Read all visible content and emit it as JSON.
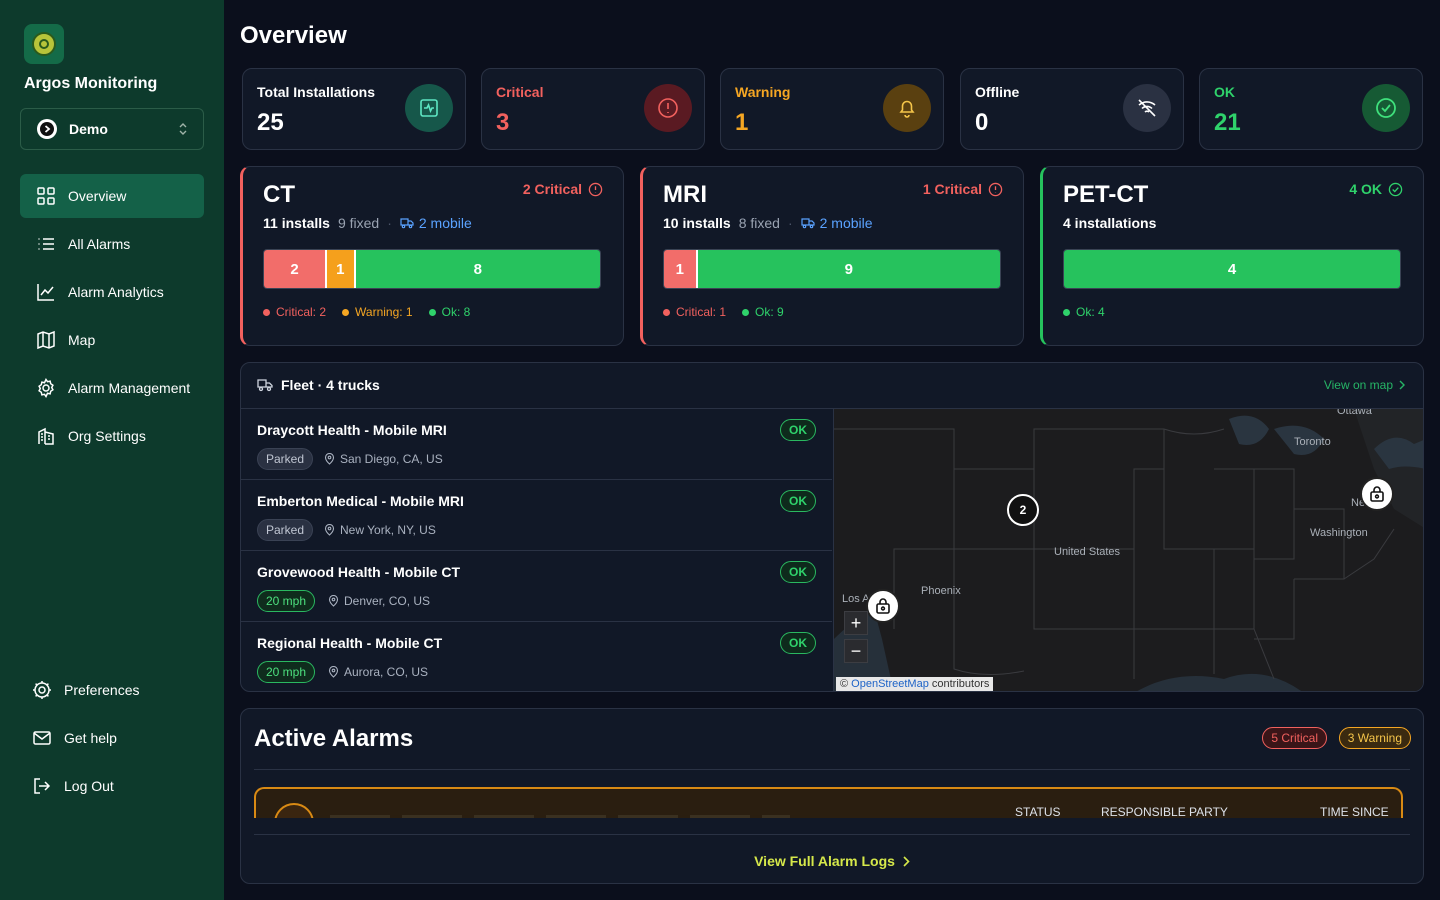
{
  "app": {
    "name": "Argos Monitoring",
    "org": "Demo"
  },
  "nav": {
    "items": [
      {
        "label": "Overview",
        "icon": "grid-icon",
        "active": true
      },
      {
        "label": "All Alarms",
        "icon": "list-icon"
      },
      {
        "label": "Alarm Analytics",
        "icon": "chart-line-icon"
      },
      {
        "label": "Map",
        "icon": "map-icon"
      },
      {
        "label": "Alarm Management",
        "icon": "gear-icon"
      },
      {
        "label": "Org Settings",
        "icon": "building-icon"
      }
    ],
    "bottom": [
      {
        "label": "Preferences",
        "icon": "cog-icon"
      },
      {
        "label": "Get help",
        "icon": "mail-icon"
      },
      {
        "label": "Log Out",
        "icon": "logout-icon"
      }
    ]
  },
  "page": {
    "title": "Overview"
  },
  "stats": [
    {
      "label": "Total Installations",
      "value": "25",
      "color": "#ffffff",
      "icon": "activity-icon"
    },
    {
      "label": "Critical",
      "value": "3",
      "color": "#f2615e",
      "icon": "alert-circle-icon"
    },
    {
      "label": "Warning",
      "value": "1",
      "color": "#f5a623",
      "icon": "bell-icon"
    },
    {
      "label": "Offline",
      "value": "0",
      "color": "#ffffff",
      "icon": "wifi-off-icon"
    },
    {
      "label": "OK",
      "value": "21",
      "color": "#2fd26b",
      "icon": "check-circle-icon"
    }
  ],
  "modalities": [
    {
      "name": "CT",
      "installs": "11 installs",
      "fixed": "9 fixed",
      "mobile": "2 mobile",
      "badge": "2 Critical",
      "segments": [
        {
          "value": 2,
          "label": "2"
        },
        {
          "value": 1,
          "label": "1"
        },
        {
          "value": 8,
          "label": "8"
        }
      ],
      "legend": [
        "Critical: 2",
        "Warning: 1",
        "Ok: 8"
      ]
    },
    {
      "name": "MRI",
      "installs": "10 installs",
      "fixed": "8 fixed",
      "mobile": "2 mobile",
      "badge": "1 Critical",
      "segments": [
        {
          "value": 1,
          "label": "1"
        },
        {
          "value": 9,
          "label": "9"
        }
      ],
      "legend": [
        "Critical: 1",
        "Ok: 9"
      ]
    },
    {
      "name": "PET-CT",
      "installs": "4 installations",
      "badge": "4 OK",
      "segments": [
        {
          "value": 4,
          "label": "4"
        }
      ],
      "legend": [
        "Ok: 4"
      ]
    }
  ],
  "fleet": {
    "title": "Fleet · 4 trucks",
    "link": "View on map",
    "trucks": [
      {
        "name": "Draycott Health - Mobile MRI",
        "status": "OK",
        "state": "Parked",
        "location": "San Diego, CA, US"
      },
      {
        "name": "Emberton Medical - Mobile MRI",
        "status": "OK",
        "state": "Parked",
        "location": "New York, NY, US"
      },
      {
        "name": "Grovewood Health - Mobile CT",
        "status": "OK",
        "state": "20 mph",
        "location": "Denver, CO, US"
      },
      {
        "name": "Regional Health - Mobile CT",
        "status": "OK",
        "state": "20 mph",
        "location": "Aurora, CO, US"
      }
    ]
  },
  "map": {
    "labels": {
      "ottawa": "Ottawa",
      "toronto": "Toronto",
      "new_york": "Ne   rk",
      "washington": "Washington",
      "us": "United States",
      "phoenix": "Phoenix",
      "la": "Los A"
    },
    "cluster": "2",
    "zoom_in": "+",
    "zoom_out": "−",
    "attribution_link": "OpenStreetMap",
    "attribution_text": " contributors",
    "attribution_prefix": "© "
  },
  "alarms": {
    "title": "Active Alarms",
    "critical_pill": "5 Critical",
    "warning_pill": "3 Warning",
    "columns": [
      "STATUS",
      "RESPONSIBLE PARTY",
      "TIME SINCE"
    ],
    "view_logs": "View Full Alarm Logs"
  }
}
